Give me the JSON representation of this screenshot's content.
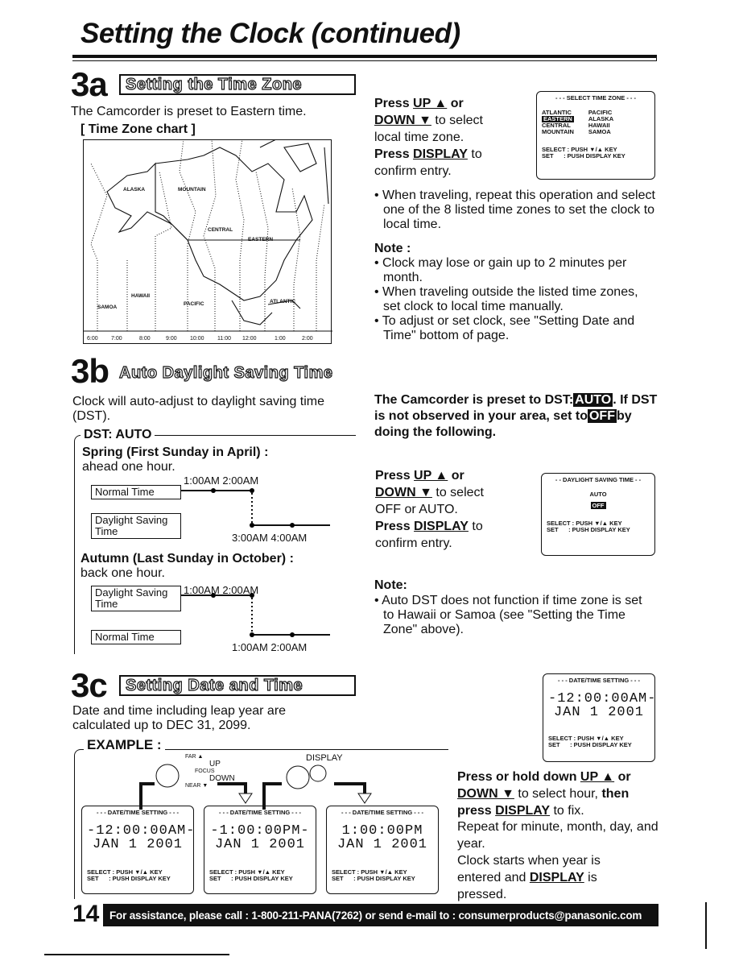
{
  "title": "Setting the Clock (continued)",
  "s3a": {
    "num": "3a",
    "heading": "Setting the Time Zone",
    "intro": "The Camcorder is preset to Eastern time.",
    "chart_label": "[ Time Zone chart ]",
    "map_labels": [
      "ALASKA",
      "MOUNTAIN",
      "CENTRAL",
      "EASTERN",
      "HAWAII",
      "SAMOA",
      "PACIFIC",
      "ATLANTIC"
    ],
    "hours": [
      "6:00",
      "7:00",
      "8:00",
      "9:00",
      "10:00",
      "11:00",
      "12:00",
      "1:00",
      "2:00"
    ],
    "steps": [
      [
        "Press ",
        "UP ▲",
        " or"
      ],
      [
        "DOWN ▼",
        " to select"
      ],
      [
        "local time zone."
      ],
      [
        "Press ",
        "DISPLAY",
        " to"
      ],
      [
        "confirm entry."
      ]
    ],
    "screen": {
      "header": "- - - SELECT TIME ZONE - - -",
      "left": [
        "ATLANTIC",
        "EASTERN",
        "CENTRAL",
        "MOUNTAIN"
      ],
      "right": [
        "PACIFIC",
        "ALASKA",
        "HAWAII",
        "SAMOA"
      ],
      "select": "SELECT : PUSH ▼/▲ KEY",
      "set": "SET      : PUSH DISPLAY KEY"
    },
    "bullet": "• When traveling, repeat this operation and select one of the 8 listed time zones to set the clock to local time.",
    "note_title": "Note :",
    "notes": [
      "• Clock may lose or gain up to 2 minutes per month.",
      "• When traveling outside the listed time zones, set clock to local time manually.",
      "• To adjust or set clock, see \"Setting Date and Time\" bottom of page."
    ]
  },
  "s3b": {
    "num": "3b",
    "heading": "Auto Daylight Saving Time",
    "intro": "Clock will auto-adjust to daylight saving time (DST).",
    "box_title": "DST: AUTO",
    "spring": "Spring (First Sunday in April) :",
    "spring_sub": "ahead one hour.",
    "normal_time": "Normal Time",
    "daylight": "Daylight Saving Time",
    "t1": "1:00AM  2:00AM",
    "t2": "3:00AM  4:00AM",
    "autumn": "Autumn (Last Sunday in October) :",
    "autumn_sub": "back one hour.",
    "t3": "1:00AM  2:00AM",
    "t4": "1:00AM  2:00AM",
    "preset": "The Camcorder is preset to DST:",
    "preset_auto": "AUTO",
    "preset2": "If DST is not observed in your area, set to",
    "preset_off": "OFF",
    "preset3": "by doing the following.",
    "steps_l1": "Press ",
    "up": "UP ▲",
    " or": " or",
    "down": "DOWN ▼",
    "sel": " to select",
    "opt": "OFF or AUTO.",
    "press": "Press ",
    "display": "DISPLAY",
    "to": " to",
    "confirm": "confirm entry.",
    "screen": {
      "header": "- - DAYLIGHT SAVING TIME - -",
      "auto": "AUTO",
      "off": "OFF",
      "select": "SELECT : PUSH ▼/▲ KEY",
      "set": "SET      : PUSH DISPLAY KEY"
    },
    "note_title": "Note:",
    "note": "• Auto DST does not function if time zone is set to Hawaii or Samoa (see \"Setting the Time Zone\" above)."
  },
  "s3c": {
    "num": "3c",
    "heading": "Setting Date and Time",
    "intro": "Date and time including leap year are calculated up to DEC 31, 2099.",
    "example": "EXAMPLE :",
    "far": "FAR ▲",
    "up": "UP",
    "focus": "FOCUS",
    "down": "DOWN",
    "near": "NEAR ▼",
    "display": "DISPLAY",
    "screens": [
      {
        "header": "- - - DATE/TIME SETTING - - -",
        "l1": "-12:00:00AM-",
        "l2": "JAN  1 2001"
      },
      {
        "header": "- - - DATE/TIME SETTING - - -",
        "l1": "-1:00:00PM-",
        "l2": "JAN  1 2001"
      },
      {
        "header": "- - - DATE/TIME SETTING - - -",
        "l1": "1:00:00PM",
        "l2": "JAN  1 2001"
      }
    ],
    "right_screen": {
      "header": "- - - DATE/TIME SETTING - - -",
      "l1": "-12:00:00AM-",
      "l2": "JAN  1 2001"
    },
    "select": "SELECT : PUSH ▼/▲ KEY",
    "set": "SET      : PUSH DISPLAY KEY",
    "p1a": "Press or hold down ",
    "p1up": "UP ▲",
    " p1or": " or",
    "p1down": "DOWN ▼",
    "p1b": " to select hour, ",
    "p1then": "then",
    "p1c": "press ",
    "p1disp": "DISPLAY",
    "p1d": " to fix.",
    "p2": "Repeat for minute, month, day, and year.",
    "p3a": "Clock starts when year is entered and ",
    "p3disp": "DISPLAY",
    "p3b": " is pressed."
  },
  "footer": {
    "page": "14",
    "assist": "For assistance, please call : 1-800-211-PANA(7262) or send e-mail to : consumerproducts@panasonic.com"
  }
}
